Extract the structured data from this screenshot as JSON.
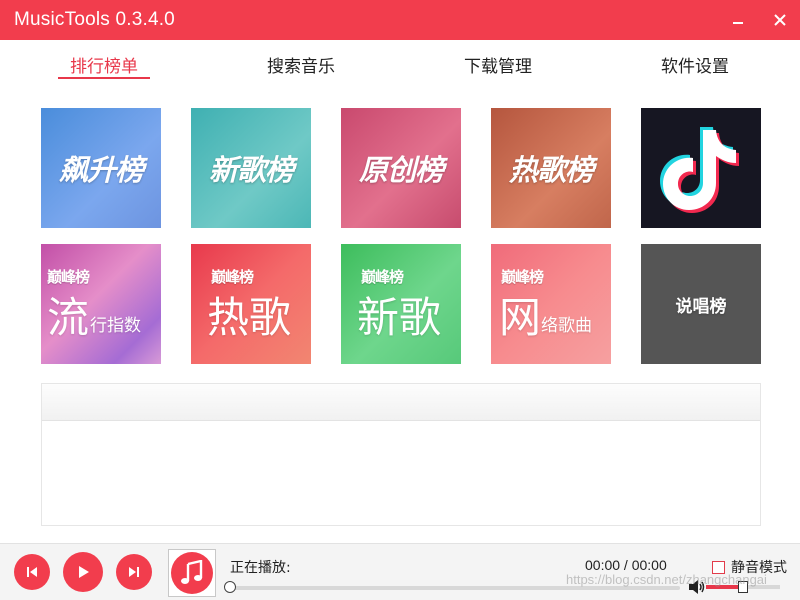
{
  "window": {
    "title": "MusicTools 0.3.4.0",
    "minimize_glyph": "–",
    "close_glyph": "✕"
  },
  "tabs": [
    {
      "label": "排行榜单",
      "active": true
    },
    {
      "label": "搜索音乐",
      "active": false
    },
    {
      "label": "下载管理",
      "active": false
    },
    {
      "label": "软件设置",
      "active": false
    }
  ],
  "charts": [
    {
      "label": "飙升榜",
      "icon": "soaring-chart-tile"
    },
    {
      "label": "新歌榜",
      "icon": "new-songs-chart-tile"
    },
    {
      "label": "原创榜",
      "icon": "original-chart-tile"
    },
    {
      "label": "热歌榜",
      "icon": "hot-songs-chart-tile"
    },
    {
      "label": "",
      "icon": "tiktok-logo"
    },
    {
      "logo": "巅峰榜",
      "big": "流",
      "small": "行指数",
      "icon": "peak-popular-index-tile"
    },
    {
      "logo": "巅峰榜",
      "big": "热歌",
      "small": "",
      "icon": "peak-hot-songs-tile"
    },
    {
      "logo": "巅峰榜",
      "big": "新歌",
      "small": "",
      "icon": "peak-new-songs-tile"
    },
    {
      "logo": "巅峰榜",
      "big": "网",
      "small": "络歌曲",
      "icon": "peak-internet-songs-tile"
    },
    {
      "label": "说唱榜",
      "icon": "rap-chart-tile"
    }
  ],
  "player": {
    "now_playing_label": "正在播放:",
    "time": "00:00 / 00:00",
    "progress": 0,
    "mute_label": "静音模式",
    "muted": false,
    "volume": 0.5
  },
  "watermark": "https://blog.csdn.net/zhangchangai",
  "colors": {
    "accent": "#f23d4d",
    "tab_active": "#e8374a"
  }
}
